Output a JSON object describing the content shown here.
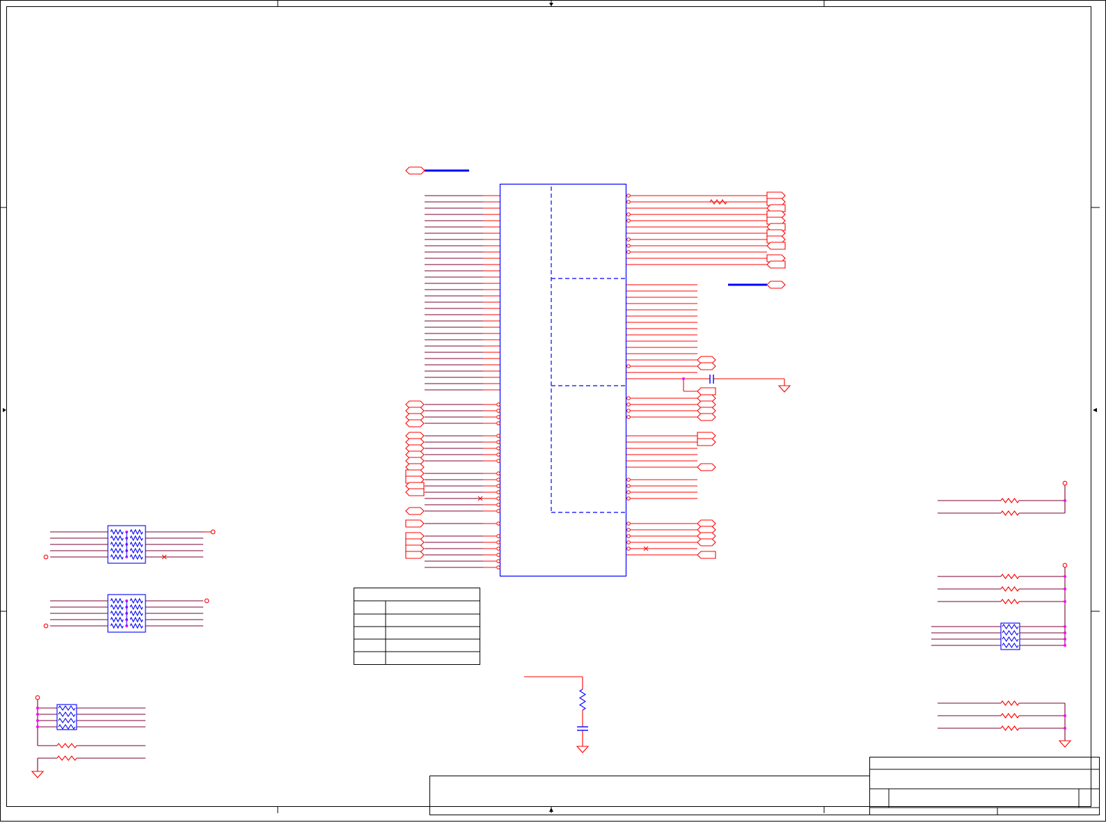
{
  "colors": {
    "frame": "#000000",
    "wire": "#7a0030",
    "pin": "#ff0000",
    "part": "#0000ff",
    "junction": "#ff00ff"
  },
  "icons": {
    "ground": "ground-icon",
    "power": "power-pin-icon",
    "resistor": "resistor-icon",
    "capacitor": "capacitor-icon",
    "port": "offpage-connector-icon",
    "resistor_network": "resistor-network-icon"
  }
}
